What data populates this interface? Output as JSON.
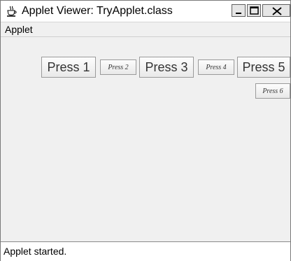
{
  "window": {
    "title": "Applet Viewer: TryApplet.class",
    "controls": [
      "minimize-icon",
      "maximize-icon",
      "close-icon"
    ]
  },
  "menubar": {
    "items": [
      "Applet"
    ]
  },
  "buttons": {
    "b1": "Press 1",
    "b2": "Press 2",
    "b3": "Press 3",
    "b4": "Press 4",
    "b5": "Press 5",
    "b6": "Press 6"
  },
  "status": {
    "text": "Applet started."
  }
}
